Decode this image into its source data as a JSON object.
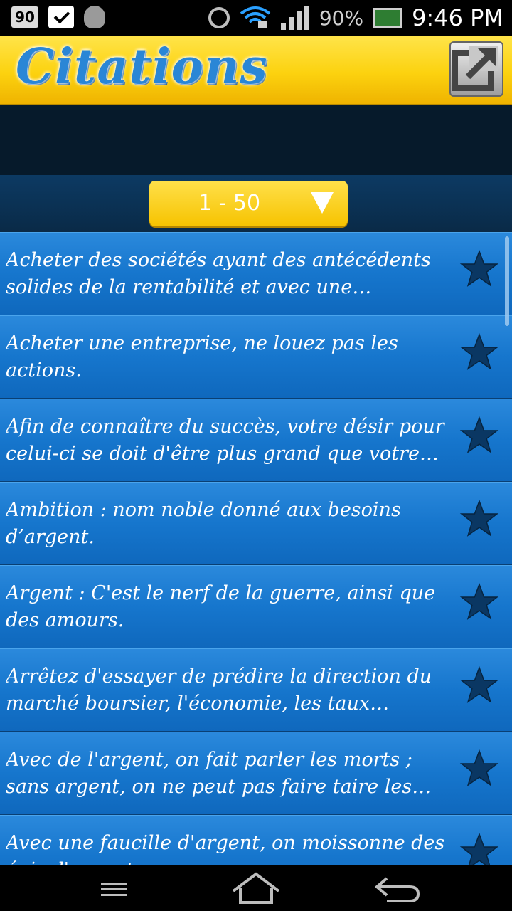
{
  "status_bar": {
    "notification_count": "90",
    "battery_percent": "90%",
    "time": "9:46 PM",
    "icons": [
      "notification-count-icon",
      "clipboard-check-icon",
      "bug-icon",
      "alarm-icon",
      "wifi-icon",
      "signal-icon",
      "battery-icon"
    ]
  },
  "header": {
    "title": "Citations",
    "share_icon": "share-icon"
  },
  "range_selector": {
    "label": "1 - 50"
  },
  "quotes": [
    {
      "text": "Acheter des sociétés ayant des antécédents solides de la rentabilité et avec une franchise..."
    },
    {
      "text": "Acheter une entreprise, ne louez pas les actions."
    },
    {
      "text": "Afin de connaître du succès, votre désir pour celui-ci se doit d'être plus grand que votre peu..."
    },
    {
      "text": "Ambition : nom noble donné aux besoins d’argent."
    },
    {
      "text": "Argent : C'est le nerf de la guerre, ainsi que des amours."
    },
    {
      "text": "Arrêtez d'essayer de prédire la direction du marché boursier, l'économie, les taux d'intérê..."
    },
    {
      "text": "Avec de l'argent, on fait parler les morts ; sans argent, on ne peut pas faire taire les muets."
    },
    {
      "text": "Avec une faucille d'argent, on moissonne des épis d'argent."
    }
  ],
  "colors": {
    "header_yellow": "#fcd20f",
    "title_blue": "#2a86d6",
    "row_blue": "#1676cd",
    "star_dark": "#0a3763"
  }
}
